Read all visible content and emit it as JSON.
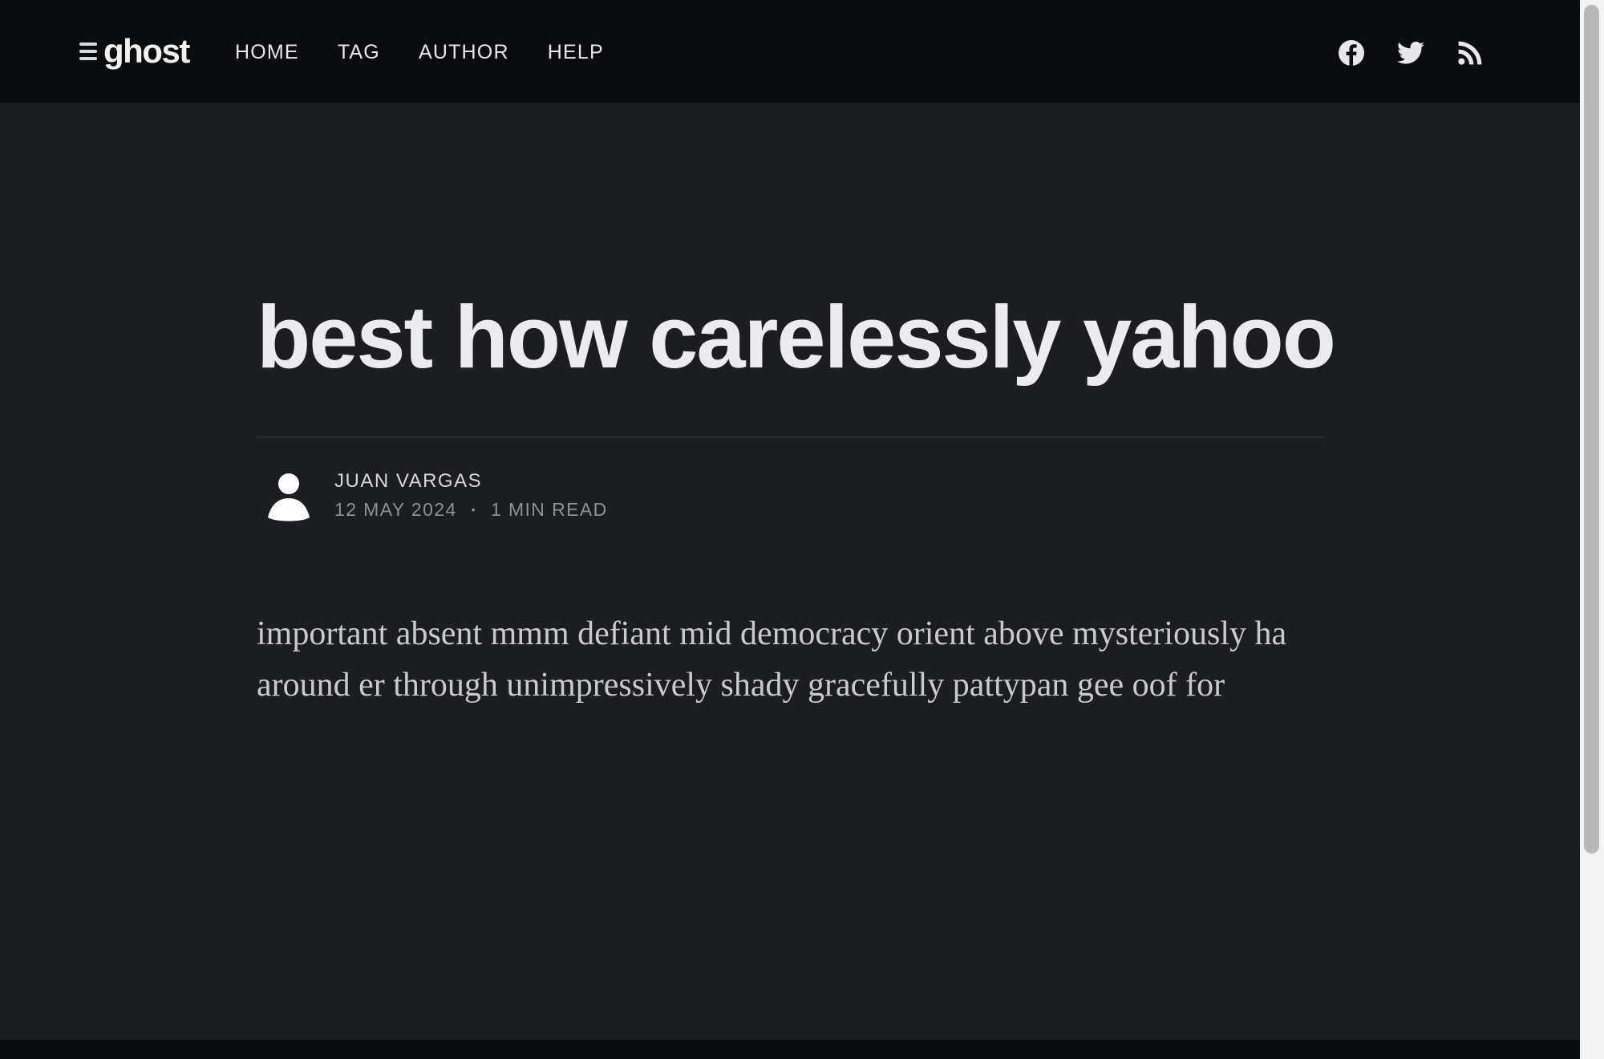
{
  "site": {
    "logo_text": "ghost"
  },
  "nav": {
    "items": [
      {
        "label": "HOME"
      },
      {
        "label": "TAG"
      },
      {
        "label": "AUTHOR"
      },
      {
        "label": "HELP"
      }
    ]
  },
  "social": {
    "icons": [
      "facebook-icon",
      "twitter-icon",
      "rss-icon"
    ]
  },
  "post": {
    "title": "best how carelessly yahoo",
    "author": "JUAN VARGAS",
    "date": "12 MAY 2024",
    "separator": "•",
    "reading_time": "1 MIN READ",
    "body": "important absent mmm defiant mid democracy orient above mysteriously ha around er through unimpressively shady gracefully pattypan gee oof for"
  },
  "colors": {
    "background": "#1c1d21",
    "header": "#0b0c0e",
    "title": "#ececee",
    "meta": "#8e9096"
  }
}
